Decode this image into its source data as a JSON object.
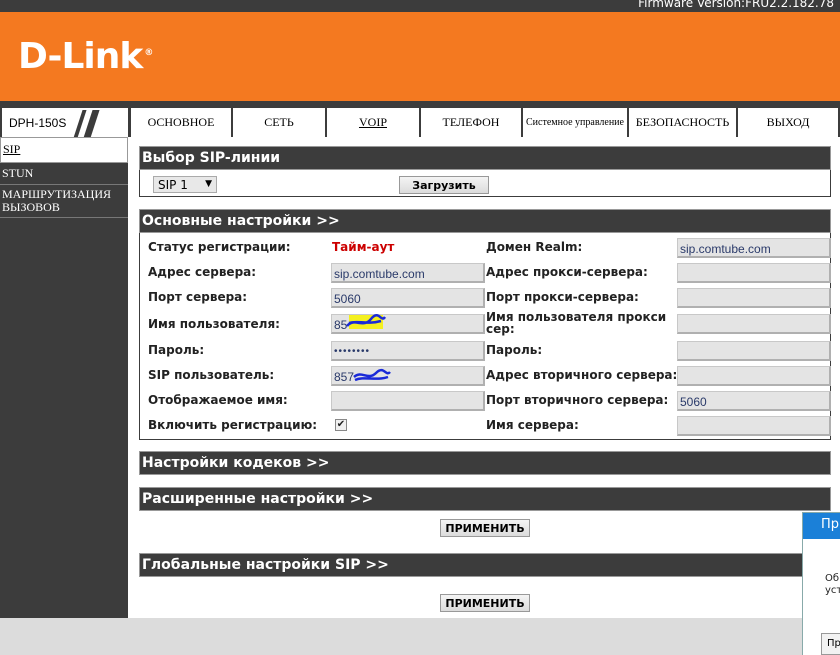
{
  "header": {
    "firmware": "Firmware Version:FRU2.2.182.78",
    "logo": "D-Link",
    "logo_reg": "®",
    "model": "DPH-150S"
  },
  "nav": {
    "tabs": [
      "ОСНОВНОЕ",
      "СЕТЬ",
      "VOIP",
      "ТЕЛЕФОН",
      "Системное управление",
      "БЕЗОПАСНОСТЬ",
      "ВЫХОД"
    ],
    "active_tab": "VOIP"
  },
  "sidebar": {
    "items": [
      "SIP",
      "STUN",
      "МАРШРУТИЗАЦИЯ ВЫЗОВОВ"
    ]
  },
  "sip_line": {
    "title": "Выбор SIP-линии",
    "selected": "SIP 1",
    "load_button": "Загрузить"
  },
  "basic": {
    "title": "Основные настройки >>",
    "left": {
      "reg_status_label": "Статус регистрации:",
      "reg_status_value": "Тайм-аут",
      "server_addr_label": "Адрес сервера:",
      "server_addr_value": "sip.comtube.com",
      "server_port_label": "Порт сервера:",
      "server_port_value": "5060",
      "username_label": "Имя пользователя:",
      "username_value": "85",
      "password_label": "Пароль:",
      "password_value": "••••••••",
      "sip_user_label": "SIP пользователь:",
      "sip_user_value": "857",
      "display_name_label": "Отображаемое имя:",
      "display_name_value": "",
      "enable_reg_label": "Включить регистрацию:",
      "enable_reg_checked": "✔"
    },
    "right": {
      "realm_label": "Домен Realm:",
      "realm_value": "sip.comtube.com",
      "proxy_addr_label": "Адрес прокси-сервера:",
      "proxy_port_label": "Порт прокси-сервера:",
      "proxy_user_label": "Имя пользователя прокси сер:",
      "proxy_pw_label": "Пароль:",
      "secondary_addr_label": "Адрес вторичного сервера:",
      "secondary_port_label": "Порт вторичного сервера:",
      "secondary_port_value": "5060",
      "server_name_label": "Имя сервера:"
    }
  },
  "codecs": {
    "title": "Настройки кодеков >>"
  },
  "advanced": {
    "title": "Расширенные настройки >>",
    "apply": "ПРИМЕНИТЬ"
  },
  "global_sip": {
    "title": "Глобальные настройки SIP >>",
    "apply": "ПРИМЕНИТЬ"
  },
  "popup": {
    "title": "Пр",
    "line1": "Об",
    "line2": "уст",
    "button": "Пр"
  },
  "colors": {
    "orange": "#f47920",
    "dark": "#3c3c3c",
    "status_red": "#cc0000",
    "popup_blue": "#1b80d8"
  }
}
